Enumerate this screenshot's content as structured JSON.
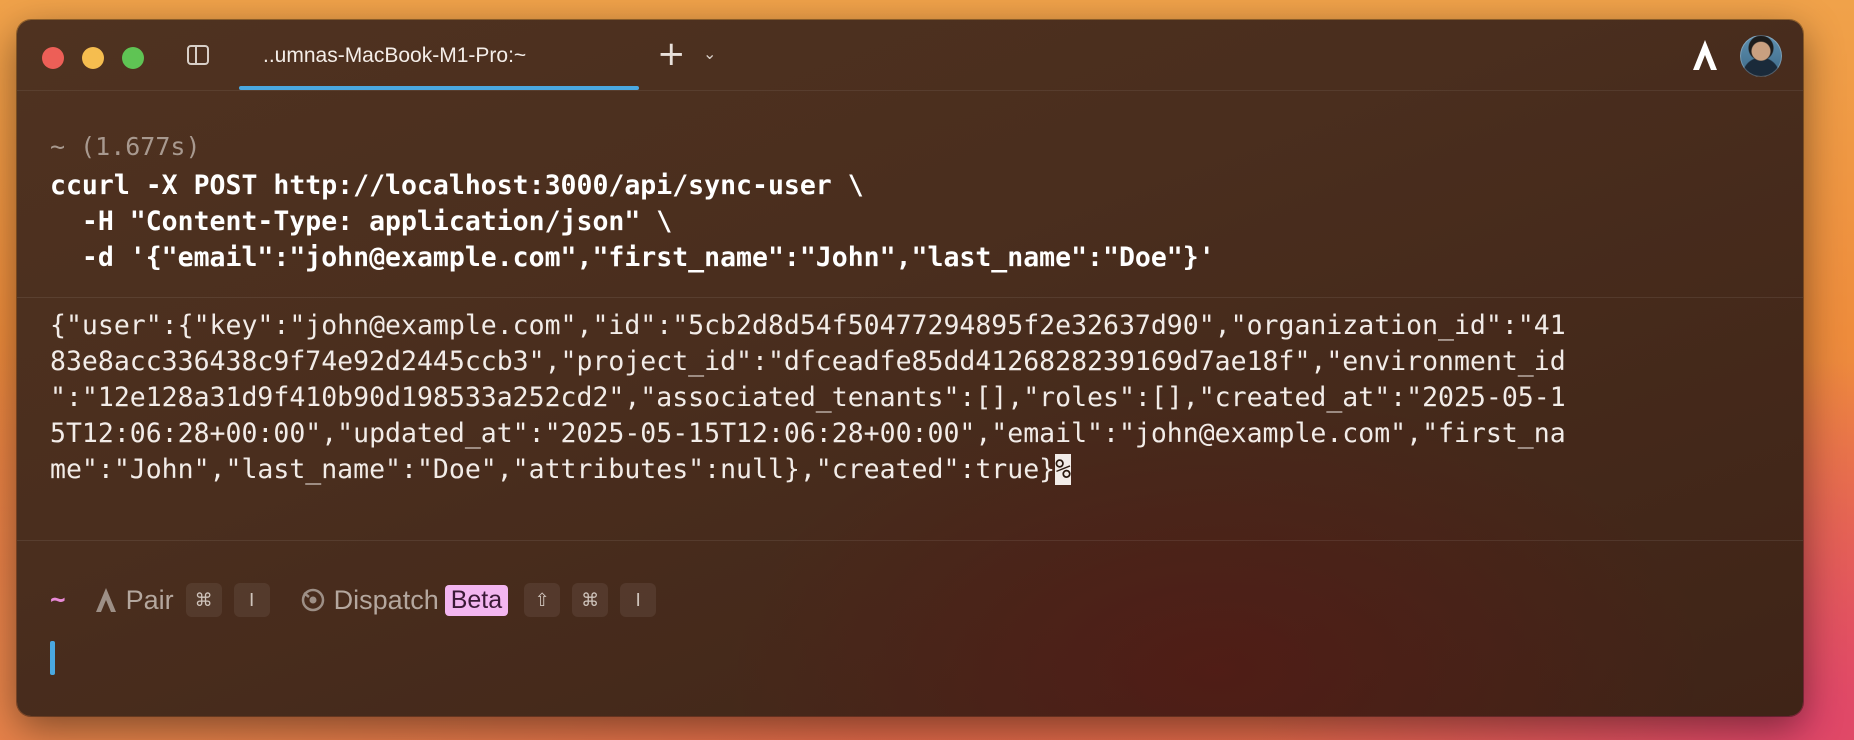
{
  "tab": {
    "title": "..umnas-MacBook-M1-Pro:~"
  },
  "toolbar": {
    "new_tab_icon": "plus-icon",
    "new_tab_menu_icon": "chevron-down-icon",
    "app_logo": "warp-logo",
    "avatar": "user-avatar"
  },
  "block": {
    "prompt_duration": "~ (1.677s)",
    "command_lines": [
      "ccurl -X POST http://localhost:3000/api/sync-user \\",
      "  -H \"Content-Type: application/json\" \\",
      "  -d '{\"email\":\"john@example.com\",\"first_name\":\"John\",\"last_name\":\"Doe\"}'"
    ],
    "output_lines": [
      "{\"user\":{\"key\":\"john@example.com\",\"id\":\"5cb2d8d54f50477294895f2e32637d90\",\"organization_id\":\"41",
      "83e8acc336438c9f74e92d2445ccb3\",\"project_id\":\"dfceadfe85dd4126828239169d7ae18f\",\"environment_id",
      "\":\"12e128a31d9f410b90d198533a252cd2\",\"associated_tenants\":[],\"roles\":[],\"created_at\":\"2025-05-1",
      "5T12:06:28+00:00\",\"updated_at\":\"2025-05-15T12:06:28+00:00\",\"email\":\"john@example.com\",\"first_na",
      "me\":\"John\",\"last_name\":\"Doe\",\"attributes\":null},\"created\":true}"
    ],
    "no_newline_marker": "%"
  },
  "input": {
    "prompt": "~",
    "pair_label": "Pair",
    "pair_keys": [
      "⌘",
      "I"
    ],
    "dispatch_label": "Dispatch",
    "dispatch_badge": "Beta",
    "dispatch_keys": [
      "⇧",
      "⌘",
      "I"
    ]
  },
  "colors": {
    "accent": "#4aa8e0",
    "prompt": "#e88ad8",
    "badge": "#f3b6f0"
  }
}
